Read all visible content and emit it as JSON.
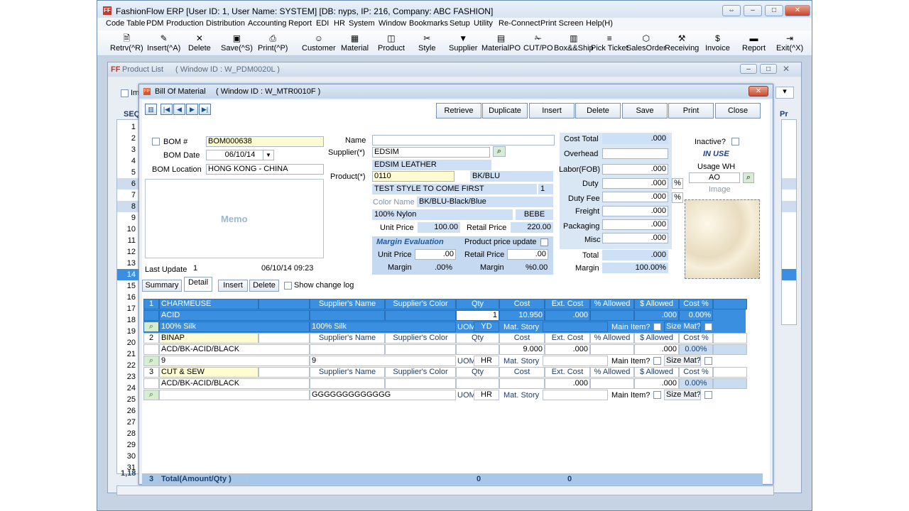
{
  "app": {
    "title": "FashionFlow ERP [User ID: 1, User Name: SYSTEM]     [DB: nyps, IP: 216, Company: ABC FASHION]",
    "menu": [
      "Code Table",
      "PDM",
      "Production",
      "Distribution",
      "Accounting",
      "Report",
      "EDI",
      "HR",
      "System",
      "Window",
      "Bookmarks",
      "Setup",
      "Utility",
      "Re-Connect",
      "Print Screen",
      "Help(H)"
    ],
    "toolbar": [
      {
        "label": "Retrv(^R)",
        "icon": "retrieve-icon"
      },
      {
        "label": "Insert(^A)",
        "icon": "insert-icon"
      },
      {
        "label": "Delete",
        "icon": "delete-icon"
      },
      {
        "label": "Save(^S)",
        "icon": "save-icon"
      },
      {
        "label": "Print(^P)",
        "icon": "print-icon"
      },
      {
        "label": "Customer",
        "icon": "customer-icon"
      },
      {
        "label": "Material",
        "icon": "material-icon"
      },
      {
        "label": "Product",
        "icon": "product-icon"
      },
      {
        "label": "Style",
        "icon": "style-icon"
      },
      {
        "label": "Supplier",
        "icon": "supplier-icon"
      },
      {
        "label": "MaterialPO",
        "icon": "materialpo-icon"
      },
      {
        "label": "CUT/PO",
        "icon": "cutpo-icon"
      },
      {
        "label": "Box&&Ship",
        "icon": "boxship-icon"
      },
      {
        "label": "Pick Ticket",
        "icon": "pickticket-icon"
      },
      {
        "label": "SalesOrder",
        "icon": "salesorder-icon"
      },
      {
        "label": "Receiving",
        "icon": "receiving-icon"
      },
      {
        "label": "Invoice",
        "icon": "invoice-icon"
      },
      {
        "label": "Report",
        "icon": "report-icon"
      },
      {
        "label": "Exit(^X)",
        "icon": "exit-icon"
      }
    ]
  },
  "product_list": {
    "title": "Product List",
    "window_id": "( Window ID : W_PDM0020L )",
    "checkbox_label": "Im",
    "seq_header": "SEQ",
    "pr_header": "Pr",
    "footer_count": "1,18",
    "rows": [
      "1",
      "2",
      "3",
      "4",
      "5",
      "6",
      "7",
      "8",
      "9",
      "10",
      "11",
      "12",
      "13",
      "14",
      "15",
      "16",
      "17",
      "18",
      "19",
      "20",
      "21",
      "22",
      "23",
      "24",
      "25",
      "26",
      "27",
      "28",
      "29",
      "30",
      "31"
    ]
  },
  "bom": {
    "title": "Bill Of Material",
    "window_id": "( Window ID : W_MTR0010F )",
    "buttons": [
      "Retrieve",
      "Duplicate",
      "Insert",
      "Delete",
      "Save",
      "Print",
      "Close"
    ],
    "bom_no_label": "BOM #",
    "bom_no": "BOM000638",
    "bom_date_label": "BOM Date",
    "bom_date": "06/10/14",
    "bom_location_label": "BOM Location",
    "bom_location": "HONG KONG - CHINA",
    "memo_label": "Memo",
    "last_update_label": "Last Update",
    "last_update_user": "1",
    "last_update_time": "06/10/14 09:23",
    "name_label": "Name",
    "name_value": "",
    "supplier_label": "Supplier(*)",
    "supplier_code": "EDSIM",
    "supplier_name": "EDSIM LEATHER",
    "product_label": "Product(*)",
    "product_code": "0110",
    "product_color": "BK/BLU",
    "product_desc": "TEST STYLE TO COME FIRST",
    "product_desc_num": "1",
    "color_name_label": "Color Name",
    "color_name": "BK/BLU-Black/Blue",
    "fabric": "100% Nylon",
    "brand": "BEBE",
    "unit_price_label": "Unit Price",
    "unit_price": "100.00",
    "retail_price_label": "Retail Price",
    "retail_price": "220.00",
    "margin_eval_label": "Margin Evaluation",
    "product_price_update_label": "Product price update",
    "me_unit_price_label": "Unit Price",
    "me_unit_price": ".00",
    "me_retail_price_label": "Retail Price",
    "me_retail_price": ".00",
    "me_margin_label": "Margin",
    "me_margin": ".00%",
    "me_margin2_label": "Margin",
    "me_margin2": "%0.00",
    "cost_total_label": "Cost Total",
    "cost_total": ".000",
    "overhead_label": "Overhead",
    "overhead": "",
    "labor_label": "Labor(FOB)",
    "labor": ".000",
    "duty_label": "Duty",
    "duty": ".000",
    "duty_fee_label": "Duty Fee",
    "duty_fee": ".000",
    "freight_label": "Freight",
    "freight": ".000",
    "packaging_label": "Packaging",
    "packaging": ".000",
    "misc_label": "Misc",
    "misc": ".000",
    "total_label": "Total",
    "total": ".000",
    "margin_label": "Margin",
    "margin": "100.00%",
    "inactive_label": "Inactive?",
    "in_use": "IN USE",
    "usage_wh_label": "Usage WH",
    "usage_wh": "AO",
    "image_label": "Image",
    "tabs": [
      "Summary",
      "Detail"
    ],
    "insert_btn": "Insert",
    "delete_btn": "Delete",
    "show_change_log": "Show change log",
    "grid_headers": {
      "supplier_name": "Supplier's Name",
      "supplier_color": "Supplier's Color",
      "qty": "Qty",
      "cost": "Cost",
      "ext_cost": "Ext. Cost",
      "pct_allowed": "% Allowed",
      "dollar_allowed": "$ Allowed",
      "cost_pct": "Cost %"
    },
    "uom_label": "UOM",
    "mat_story_label": "Mat. Story",
    "main_item_label": "Main Item?",
    "size_mat_label": "Size Mat?",
    "items": [
      {
        "no": "1",
        "name": "CHARMEUSE",
        "code": "ACID",
        "desc": "100% Silk",
        "desc2": "100% Silk",
        "uom": "YD",
        "qty": "1",
        "cost": "10.950",
        "ext": ".000",
        "dallow": ".000",
        "costpct": "0.00%"
      },
      {
        "no": "2",
        "name": "BINAP",
        "code": "ACD/BK-ACID/BLACK",
        "desc": "9",
        "desc2": "9",
        "uom": "HR",
        "qty": "",
        "cost": "9.000",
        "ext": ".000",
        "dallow": ".000",
        "costpct": "0.00%"
      },
      {
        "no": "3",
        "name": "CUT & SEW",
        "code": "ACD/BK-ACID/BLACK",
        "desc": "",
        "desc2": "GGGGGGGGGGGGG",
        "uom": "HR",
        "qty": "",
        "cost": "",
        "ext": ".000",
        "dallow": ".000",
        "costpct": "0.00%"
      }
    ],
    "total_row_no": "3",
    "total_label_grid": "Total(Amount/Qty )",
    "total_qty": "0",
    "total_amount": "0"
  }
}
